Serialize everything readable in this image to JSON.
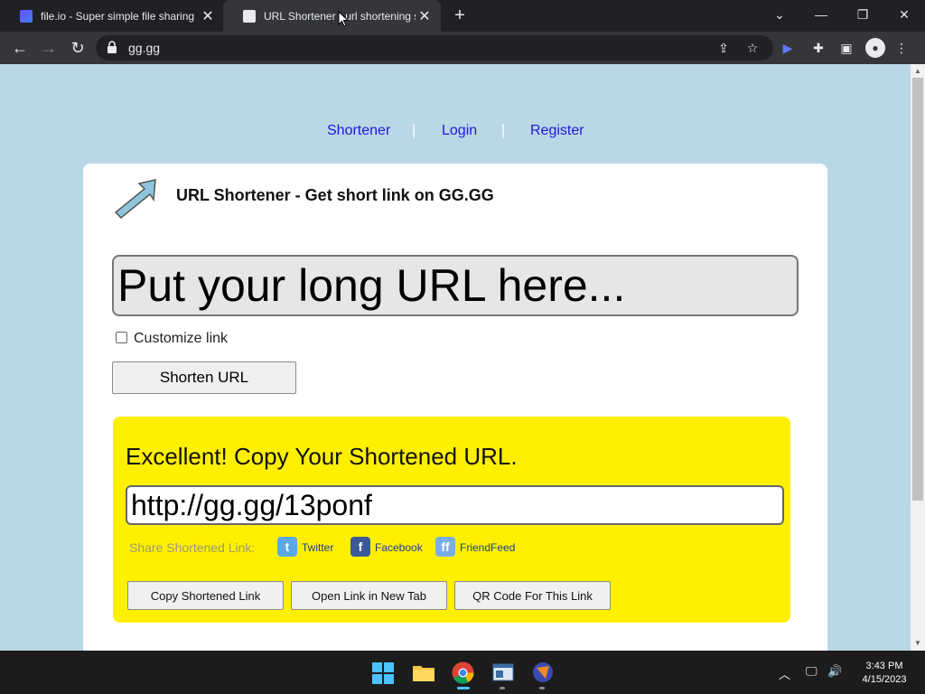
{
  "browser": {
    "tabs": [
      {
        "title": "file.io - Super simple file sharing",
        "active": false
      },
      {
        "title": "URL Shortener - url shortening se",
        "active": true
      }
    ],
    "address": "gg.gg",
    "icons": [
      "back-icon",
      "forward-icon",
      "reload-icon",
      "lock-icon",
      "share-icon",
      "star-icon",
      "extension-icon",
      "puzzle-icon",
      "sidepanel-icon",
      "profile-icon",
      "menu-icon"
    ]
  },
  "nav": {
    "shortener": "Shortener",
    "login": "Login",
    "register": "Register",
    "separator": "|"
  },
  "main": {
    "title": "URL Shortener - Get short link on GG.GG",
    "url_placeholder": "Put your long URL here...",
    "customize_label": "Customize link",
    "shorten_button": "Shorten URL"
  },
  "result": {
    "heading": "Excellent! Copy Your Shortened URL.",
    "short_url": "http://gg.gg/13ponf",
    "share_label": "Share Shortened Link:",
    "share": [
      {
        "name": "Twitter",
        "color": "#5aa9e6"
      },
      {
        "name": "Facebook",
        "color": "#3b5998"
      },
      {
        "name": "FriendFeed",
        "color": "#7aaee8"
      }
    ],
    "buttons": {
      "copy": "Copy Shortened Link",
      "open": "Open Link in New Tab",
      "qr": "QR Code For This Link"
    }
  },
  "taskbar": {
    "time": "3:43 PM",
    "date": "4/15/2023"
  },
  "colors": {
    "page_bg": "#bad7e6",
    "result_bg": "#fff000",
    "link": "#1a1ad9"
  }
}
